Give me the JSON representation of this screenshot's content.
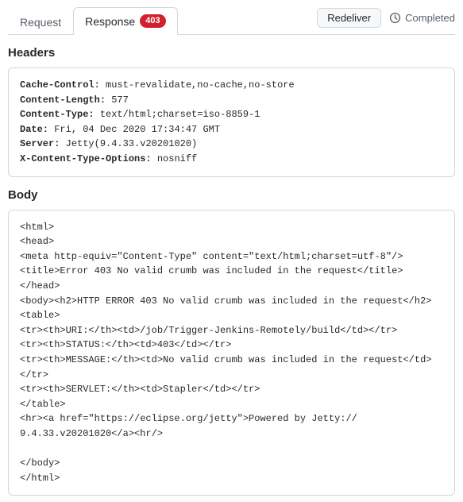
{
  "tabs": {
    "request_label": "Request",
    "response_label": "Response",
    "response_badge": "403"
  },
  "actions": {
    "redeliver_label": "Redeliver",
    "status_label": "Completed"
  },
  "sections": {
    "headers_title": "Headers",
    "body_title": "Body"
  },
  "headers": [
    {
      "key": "Cache-Control:",
      "value": " must-revalidate,no-cache,no-store"
    },
    {
      "key": "Content-Length:",
      "value": " 577"
    },
    {
      "key": "Content-Type:",
      "value": " text/html;charset=iso-8859-1"
    },
    {
      "key": "Date:",
      "value": " Fri, 04 Dec 2020 17:34:47 GMT"
    },
    {
      "key": "Server:",
      "value": " Jetty(9.4.33.v20201020)"
    },
    {
      "key": "X-Content-Type-Options:",
      "value": " nosniff"
    }
  ],
  "body_text": "<html>\n<head>\n<meta http-equiv=\"Content-Type\" content=\"text/html;charset=utf-8\"/>\n<title>Error 403 No valid crumb was included in the request</title>\n</head>\n<body><h2>HTTP ERROR 403 No valid crumb was included in the request</h2>\n<table>\n<tr><th>URI:</th><td>/job/Trigger-Jenkins-Remotely/build</td></tr>\n<tr><th>STATUS:</th><td>403</td></tr>\n<tr><th>MESSAGE:</th><td>No valid crumb was included in the request</td></tr>\n<tr><th>SERVLET:</th><td>Stapler</td></tr>\n</table>\n<hr><a href=\"https://eclipse.org/jetty\">Powered by Jetty:// 9.4.33.v20201020</a><hr/>\n\n</body>\n</html>"
}
